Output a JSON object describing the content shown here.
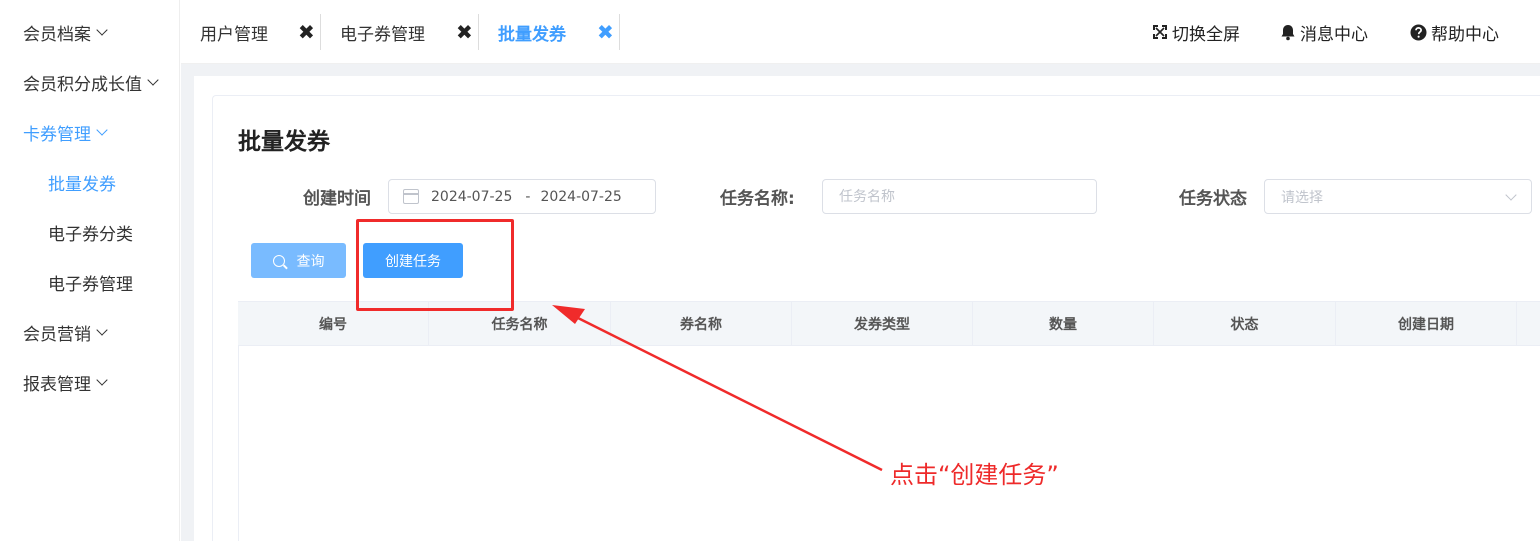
{
  "sidebar": {
    "items": [
      {
        "label": "会员档案",
        "type": "parent",
        "expanded": false
      },
      {
        "label": "会员积分成长值",
        "type": "parent",
        "expanded": false
      },
      {
        "label": "卡券管理",
        "type": "parent",
        "expanded": true,
        "active": true
      },
      {
        "label": "批量发券",
        "type": "child",
        "active": true
      },
      {
        "label": "电子券分类",
        "type": "child"
      },
      {
        "label": "电子券管理",
        "type": "child"
      },
      {
        "label": "会员营销",
        "type": "parent",
        "expanded": false
      },
      {
        "label": "报表管理",
        "type": "parent",
        "expanded": false
      }
    ]
  },
  "tabs": [
    {
      "label": "用户管理",
      "close": "✖",
      "active": false
    },
    {
      "label": "电子券管理",
      "close": "✖",
      "active": false
    },
    {
      "label": "批量发券",
      "close": "✖",
      "active": true
    }
  ],
  "toolbar": {
    "fullscreen": {
      "label": "切换全屏",
      "icon": "fullscreen-icon"
    },
    "messages": {
      "label": "消息中心",
      "icon": "bell-icon"
    },
    "help": {
      "label": "帮助中心",
      "icon": "question-circle-icon"
    }
  },
  "page": {
    "title": "批量发券",
    "filters": {
      "created_label": "创建时间",
      "date_start": "2024-07-25",
      "date_sep": "-",
      "date_end": "2024-07-25",
      "task_name_label": "任务名称:",
      "task_name_placeholder": "任务名称",
      "task_name_value": "",
      "task_status_label": "任务状态",
      "task_status_placeholder": "请选择"
    },
    "buttons": {
      "query": "查询",
      "create": "创建任务"
    },
    "table": {
      "columns": [
        "编号",
        "任务名称",
        "券名称",
        "发券类型",
        "数量",
        "状态",
        "创建日期"
      ],
      "rows": []
    }
  },
  "annotation": {
    "text": "点击“创建任务”",
    "color": "#ee2a2a"
  },
  "colors": {
    "primary": "#409eff",
    "primary_light": "#79bbff",
    "annotation_red": "#f02b2b"
  }
}
